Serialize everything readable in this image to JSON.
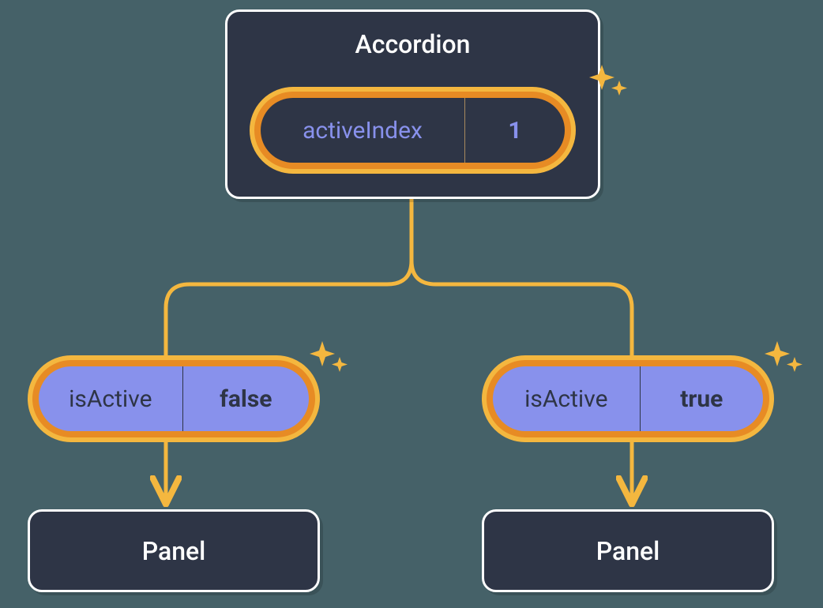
{
  "colors": {
    "bg": "#456168",
    "box_bg": "#2e3546",
    "box_border": "#ffffff",
    "accent_orange": "#f4b73f",
    "accent_orange_inner": "#e78b24",
    "lavender": "#8891ec",
    "sparkle": "#f4b73f"
  },
  "parent": {
    "title": "Accordion",
    "state": {
      "key": "activeIndex",
      "value": "1"
    }
  },
  "children": [
    {
      "label": "Panel",
      "prop": {
        "key": "isActive",
        "value": "false"
      }
    },
    {
      "label": "Panel",
      "prop": {
        "key": "isActive",
        "value": "true"
      }
    }
  ]
}
